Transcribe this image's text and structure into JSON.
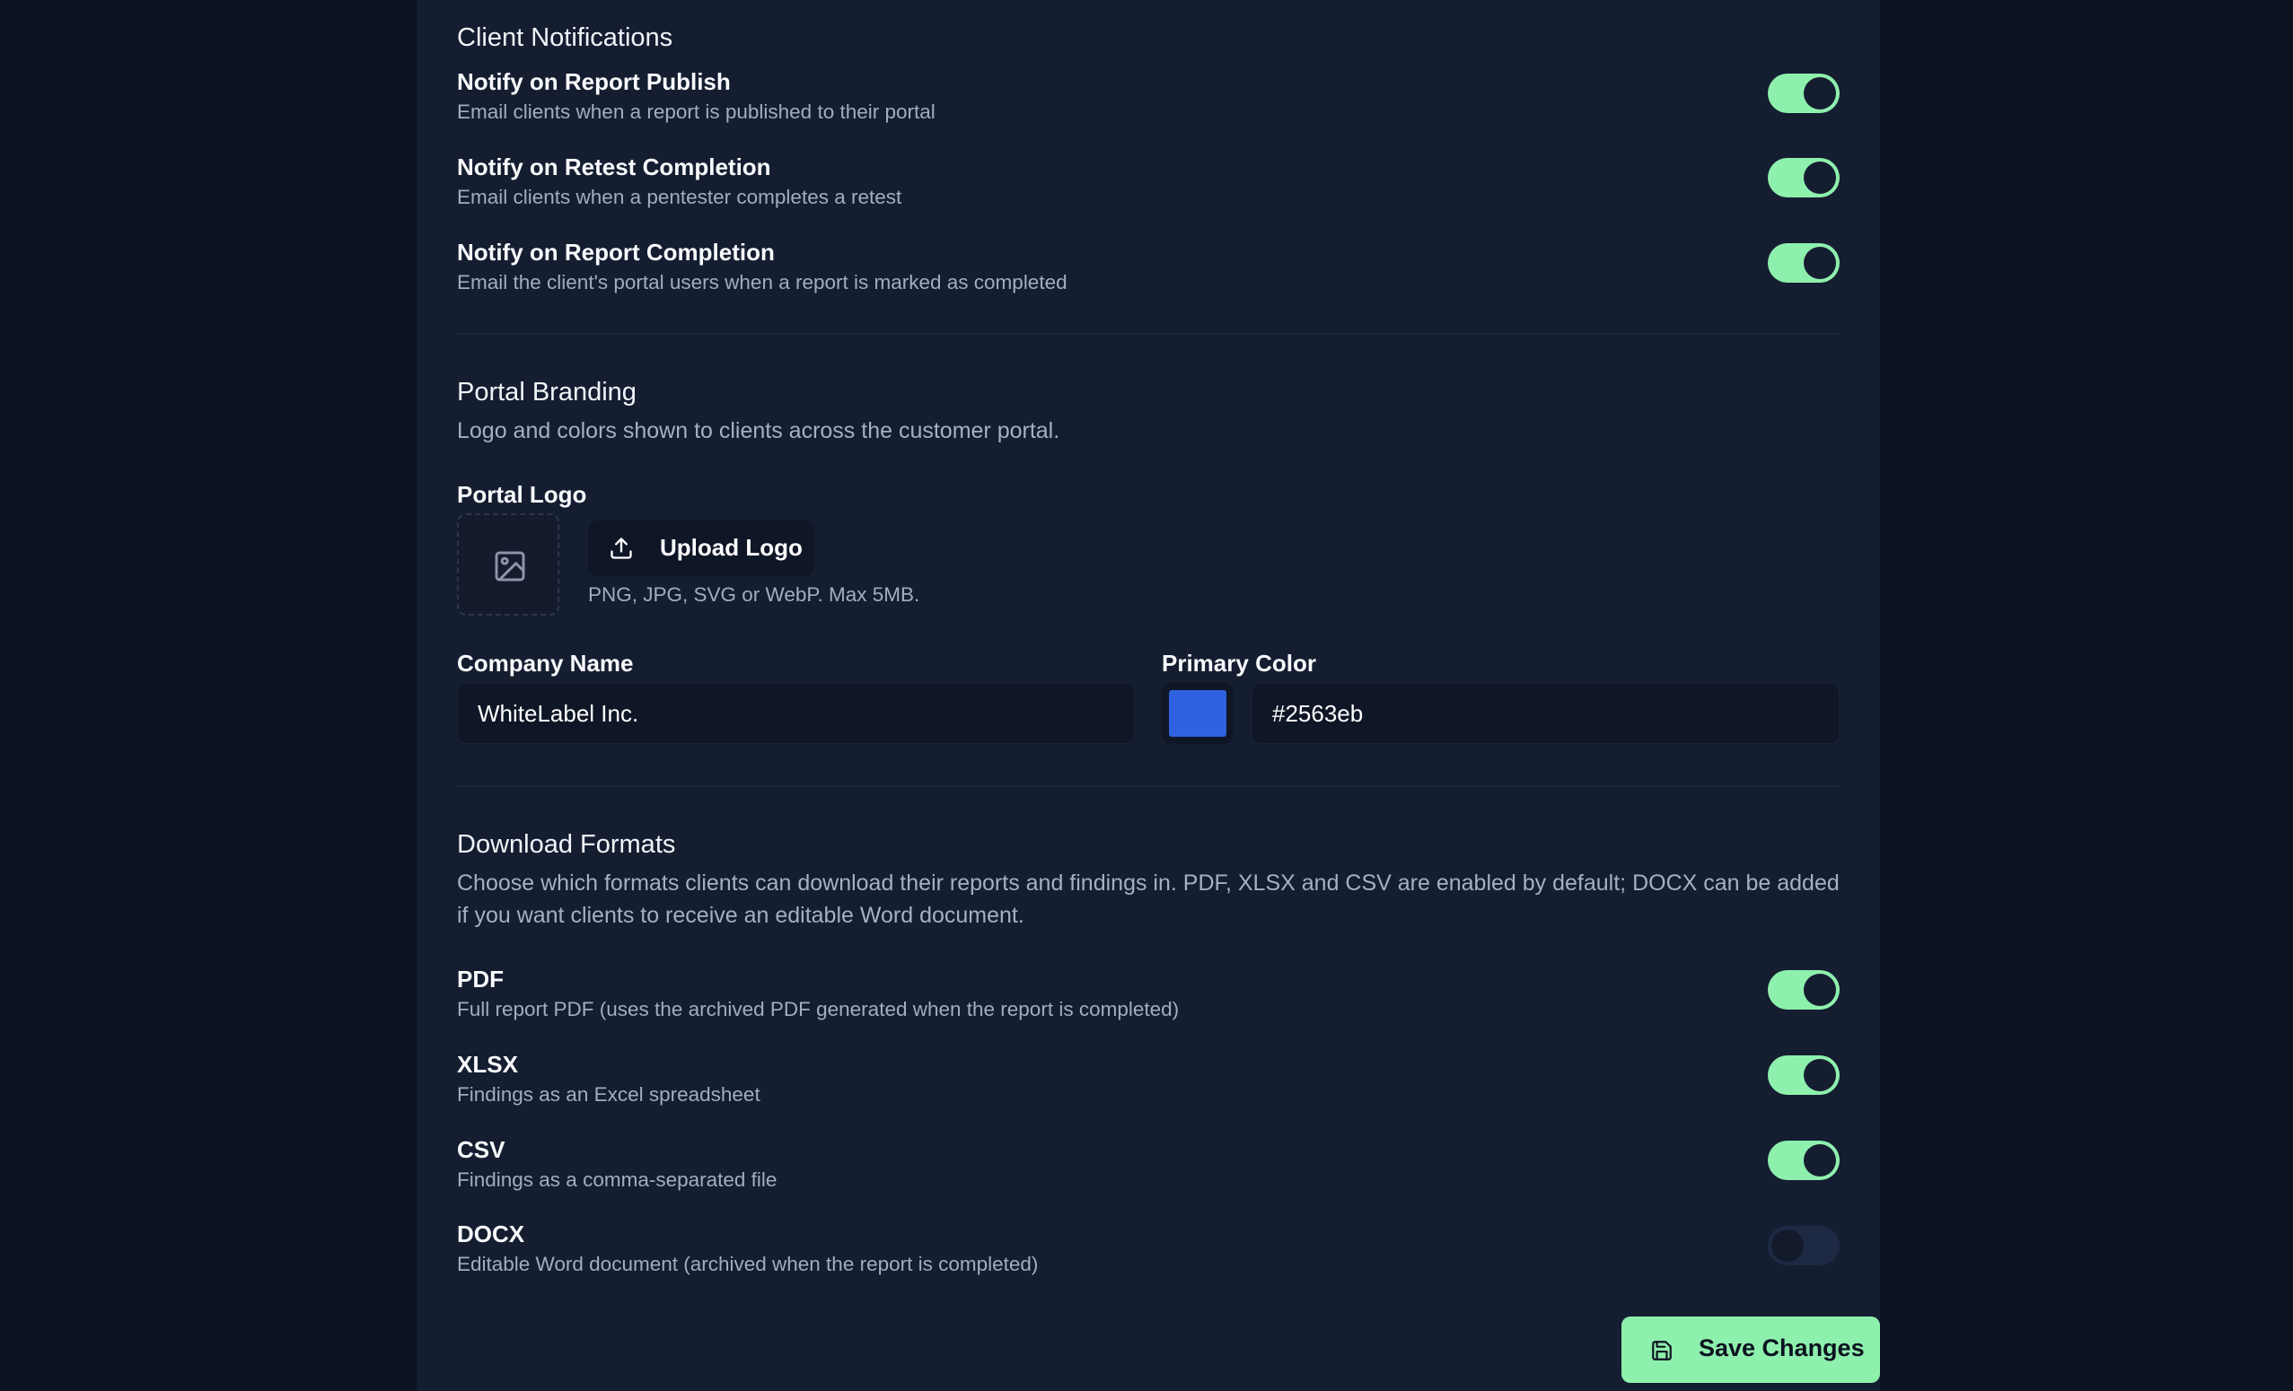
{
  "client_notifications": {
    "title": "Client Notifications",
    "items": [
      {
        "label": "Notify on Report Publish",
        "description": "Email clients when a report is published to their portal",
        "enabled": true
      },
      {
        "label": "Notify on Retest Completion",
        "description": "Email clients when a pentester completes a retest",
        "enabled": true
      },
      {
        "label": "Notify on Report Completion",
        "description": "Email the client's portal users when a report is marked as completed",
        "enabled": true
      }
    ]
  },
  "portal_branding": {
    "title": "Portal Branding",
    "description": "Logo and colors shown to clients across the customer portal.",
    "logo_label": "Portal Logo",
    "logo_placeholder_icon": "image-icon",
    "upload_button": "Upload Logo",
    "upload_icon": "upload-icon",
    "upload_hint": "PNG, JPG, SVG or WebP. Max 5MB.",
    "company_name_label": "Company Name",
    "company_name_value": "WhiteLabel Inc.",
    "primary_color_label": "Primary Color",
    "primary_color_value": "#2563eb"
  },
  "download_formats": {
    "title": "Download Formats",
    "description": "Choose which formats clients can download their reports and findings in. PDF, XLSX and CSV are enabled by default; DOCX can be added if you want clients to receive an editable Word document.",
    "items": [
      {
        "label": "PDF",
        "description": "Full report PDF (uses the archived PDF generated when the report is completed)",
        "enabled": true
      },
      {
        "label": "XLSX",
        "description": "Findings as an Excel spreadsheet",
        "enabled": true
      },
      {
        "label": "CSV",
        "description": "Findings as a comma-separated file",
        "enabled": true
      },
      {
        "label": "DOCX",
        "description": "Editable Word document (archived when the report is completed)",
        "enabled": false
      }
    ]
  },
  "actions": {
    "save_label": "Save Changes",
    "save_icon": "save-icon"
  },
  "colors": {
    "accent": "#8ef0ad",
    "panel_bg": "#151d31",
    "page_bg": "#0c1220",
    "swatch": "#2563eb"
  }
}
